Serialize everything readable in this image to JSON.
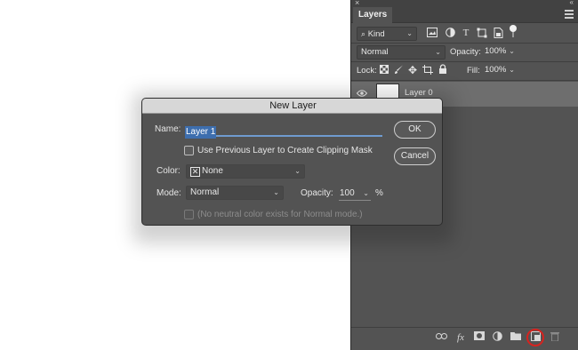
{
  "panel": {
    "top_close": "×",
    "top_collapse": "«",
    "tab": "Layers",
    "filter": {
      "value": "Kind",
      "icon": "search-icon"
    },
    "filter_icons": [
      "image-filter-icon",
      "adjustment-filter-icon",
      "type-filter-icon",
      "shape-filter-icon",
      "smart-object-filter-icon",
      "filter-toggle-icon"
    ],
    "blend_mode": "Normal",
    "opacity_label": "Opacity:",
    "opacity_value": "100%",
    "lock_label": "Lock:",
    "lock_icons": [
      "lock-transparent-icon",
      "lock-paint-icon",
      "lock-position-icon",
      "lock-artboard-icon",
      "lock-all-icon"
    ],
    "fill_label": "Fill:",
    "fill_value": "100%",
    "layer": {
      "name": "Layer 0",
      "visible": true
    },
    "footer_icons": [
      "link-icon",
      "fx-icon",
      "mask-icon",
      "adjustment-icon",
      "folder-icon",
      "new-layer-icon",
      "trash-icon"
    ],
    "fx_label": "fx",
    "highlight_color": "#d6231f"
  },
  "dialog": {
    "title": "New Layer",
    "name_label": "Name:",
    "name_value": "Layer 1",
    "clip_label": "Use Previous Layer to Create Clipping Mask",
    "color_label": "Color:",
    "color_value": "None",
    "mode_label": "Mode:",
    "mode_value": "Normal",
    "opacity_label": "Opacity:",
    "opacity_value": "100",
    "opacity_unit": "%",
    "neutral_label": "(No neutral color exists for Normal mode.)",
    "ok_label": "OK",
    "cancel_label": "Cancel"
  }
}
